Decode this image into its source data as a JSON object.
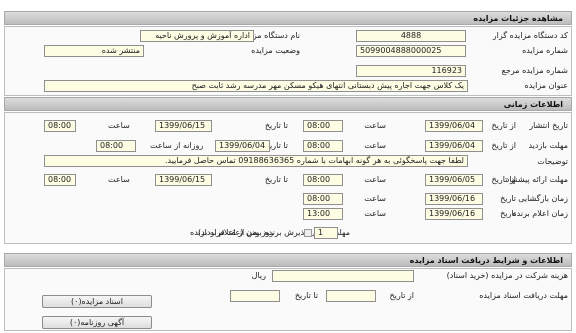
{
  "header": {
    "title": "مشاهده جزئیات مزایده"
  },
  "auction": {
    "code_label": "کد دستگاه مزایده گزار",
    "code": "4888",
    "org_label": "نام دستگاه مزایده گزار",
    "org": "اداره آموزش و پرورش ناحیه",
    "number_label": "شماره مزایده",
    "number": "5099004888000025",
    "status_label": "وضعیت مزایده",
    "status": "منتشر شده",
    "ref_label": "شماره مزایده مرجع",
    "ref": "116923",
    "subject_label": "عنوان مزایده",
    "subject": "یک کلاس  جهت اجاره پیش دبستانی انتهای هیکو  مسکن مهر  مدرسه رشد  ثابت صبح"
  },
  "times": {
    "title": "اطلاعات زمانی",
    "publish_label": "تاریخ انتشار",
    "from_label": "از تاریخ",
    "to_label": "تا تاریخ",
    "time_label": "ساعت",
    "publish_from": "1399/06/04",
    "publish_from_time": "08:00",
    "publish_to": "1399/06/15",
    "publish_to_time": "08:00",
    "visit_label": "مهلت بازدید",
    "visit_from": "1399/06/04",
    "visit_from_time": "08:00",
    "daily_label": "روزانه از ساعت",
    "visit_to": "1399/06/04",
    "visit_to_time": "08:00",
    "notes_label": "توضیحات",
    "notes": "لطفا جهت پاسخگوئی به هر گونه ابهامات با شماره 09188636365 تماس حاصل فرمایید.",
    "offer_label": "مهلت ارائه پیشنهاد",
    "offer_from": "1399/06/05",
    "offer_from_time": "08:00",
    "offer_to": "1399/06/15",
    "offer_to_time": "08:00",
    "opening_label": "زمان بازگشایی",
    "opening_date": "1399/06/16",
    "opening_time": "08:00",
    "date_label": "تاریخ",
    "winner_label": "زمان اعلام برنده",
    "winner_date": "1399/06/16",
    "winner_time": "13:00",
    "contract_label": "مهلت زمانی پذیرش برنده بودن (عقد قرارداد)",
    "contract_days": "1",
    "contract_suffix": "روز پس از اعلام به برنده"
  },
  "docs": {
    "title": "اطلاعات و شرایط دریافت اسناد مزایده",
    "fee_label": "هزینه شرکت در مزایده (خرید اسناد)",
    "currency": "ریال",
    "fee": "",
    "deadline_label": "مهلت دریافت اسناد مزایده",
    "from_label": "از تاریخ",
    "to_label": "تا تاریخ",
    "from": "",
    "to": "",
    "btn_docs": "اسناد مزایده(۰)",
    "btn_news": "آگهی روزنامه(۰)"
  },
  "watermark": {
    "numbers": "010 - 001",
    "site": "ParsNamadData.com",
    "fa1": "پارس نماد داده ها",
    "fa2": "بانک اطلاعات مناقصه و مزایده"
  }
}
